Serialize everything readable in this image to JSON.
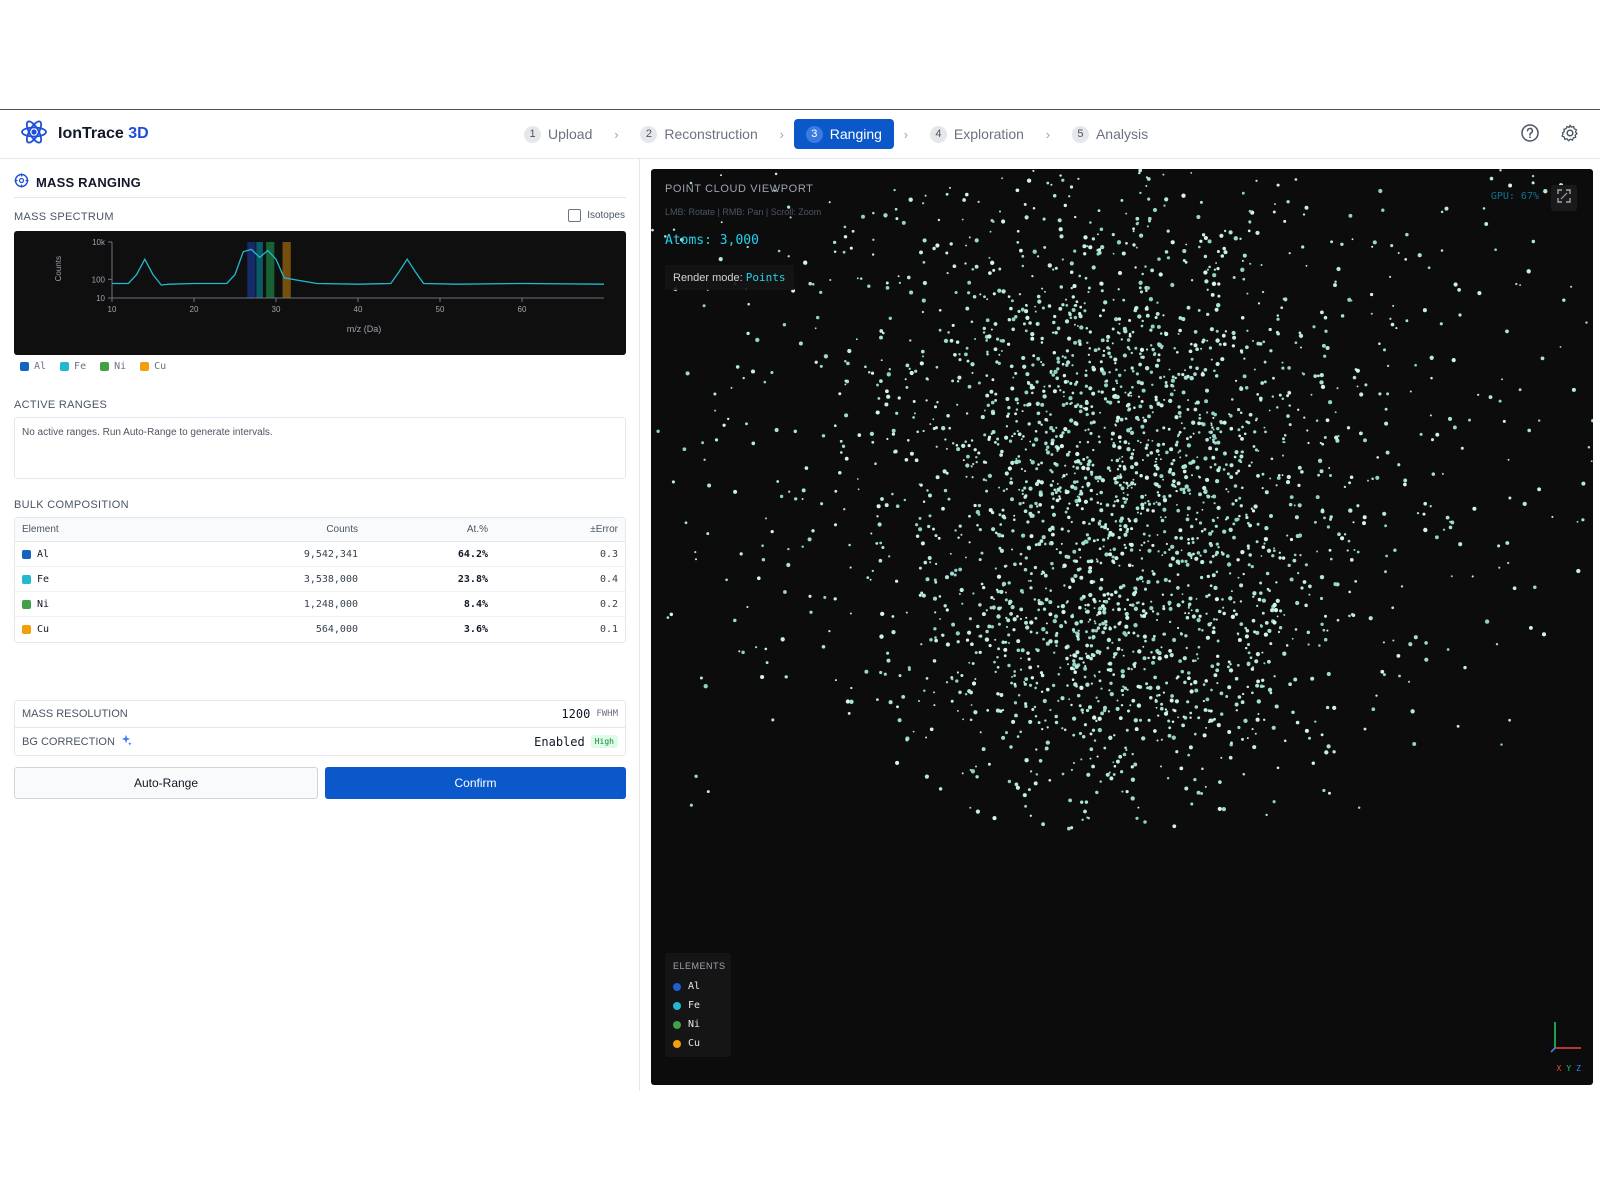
{
  "app": {
    "name_main": "IonTrace",
    "name_accent": "3D"
  },
  "steps": [
    {
      "num": "1",
      "label": "Upload",
      "active": false
    },
    {
      "num": "2",
      "label": "Reconstruction",
      "active": false
    },
    {
      "num": "3",
      "label": "Ranging",
      "active": true
    },
    {
      "num": "4",
      "label": "Exploration",
      "active": false
    },
    {
      "num": "5",
      "label": "Analysis",
      "active": false
    }
  ],
  "panel": {
    "title": "MASS RANGING"
  },
  "spectrum": {
    "label": "MASS SPECTRUM",
    "isotopes_label": "Isotopes",
    "isotopes_checked": false
  },
  "chart_data": {
    "type": "line",
    "xlabel": "m/z (Da)",
    "ylabel": "Counts",
    "y_scale": "log",
    "xlim": [
      10,
      70
    ],
    "ylim": [
      10,
      10000
    ],
    "x_ticks": [
      "10",
      "20",
      "30",
      "40",
      "50",
      "60"
    ],
    "y_ticks": [
      "10k",
      "100",
      "10"
    ],
    "series": [
      {
        "x": [
          10,
          12,
          13,
          14,
          15,
          16,
          17,
          20,
          24,
          25,
          26,
          27,
          28,
          29,
          30,
          31,
          35,
          40,
          44,
          45,
          46,
          47,
          48,
          52,
          60,
          70
        ],
        "y": [
          60,
          60,
          180,
          1200,
          180,
          50,
          55,
          60,
          60,
          180,
          3000,
          4000,
          1500,
          3500,
          1200,
          120,
          60,
          55,
          60,
          250,
          1200,
          250,
          60,
          55,
          60,
          55
        ]
      }
    ],
    "highlight_ranges": [
      {
        "element": "Al",
        "from": 26.5,
        "to": 27.5,
        "color": "#1d4ed8"
      },
      {
        "element": "Fe",
        "from": 27.6,
        "to": 28.4,
        "color": "#06b6d4"
      },
      {
        "element": "Ni",
        "from": 28.8,
        "to": 29.8,
        "color": "#22c55e"
      },
      {
        "element": "Cu",
        "from": 30.8,
        "to": 31.8,
        "color": "#f59e0b"
      }
    ]
  },
  "legend": [
    {
      "label": "Al",
      "color": "#1565c0"
    },
    {
      "label": "Fe",
      "color": "#22b8cf"
    },
    {
      "label": "Ni",
      "color": "#43a047"
    },
    {
      "label": "Cu",
      "color": "#f59e0b"
    }
  ],
  "ranges": {
    "label": "ACTIVE RANGES",
    "empty_text": "No active ranges. Run Auto-Range to generate intervals."
  },
  "composition": {
    "label": "BULK COMPOSITION",
    "headers": {
      "element": "Element",
      "counts": "Counts",
      "at": "At.%",
      "error": "±Error"
    },
    "rows": [
      {
        "element": "Al",
        "counts": "9,542,341",
        "at": "64.2%",
        "error": "0.3",
        "color": "#1565c0"
      },
      {
        "element": "Fe",
        "counts": "3,538,000",
        "at": "23.8%",
        "error": "0.4",
        "color": "#22b8cf"
      },
      {
        "element": "Ni",
        "counts": "1,248,000",
        "at": "8.4%",
        "error": "0.2",
        "color": "#43a047"
      },
      {
        "element": "Cu",
        "counts": "564,000",
        "at": "3.6%",
        "error": "0.1",
        "color": "#f59e0b"
      }
    ]
  },
  "mass_resolution": {
    "label": "MASS RESOLUTION",
    "value": "1200",
    "unit": "FWHM"
  },
  "bg_correction": {
    "label": "BG CORRECTION",
    "value": "Enabled",
    "badge": "High"
  },
  "buttons": {
    "auto_range": "Auto-Range",
    "confirm": "Confirm"
  },
  "viewport": {
    "title": "POINT CLOUD VIEWPORT",
    "hint": "LMB: Rotate | RMB: Pan | Scroll: Zoom",
    "atoms": "Atoms: 3,000",
    "render_mode_label": "Render mode:",
    "render_mode_value": "Points",
    "gpu": "GPU: 67%",
    "elements_label": "ELEMENTS",
    "elements": [
      {
        "label": "Al",
        "color": "#1d5fd6"
      },
      {
        "label": "Fe",
        "color": "#22b8cf"
      },
      {
        "label": "Ni",
        "color": "#43a047"
      },
      {
        "label": "Cu",
        "color": "#f59e0b"
      }
    ],
    "axes": {
      "x": "X",
      "y": "Y",
      "z": "Z"
    }
  }
}
